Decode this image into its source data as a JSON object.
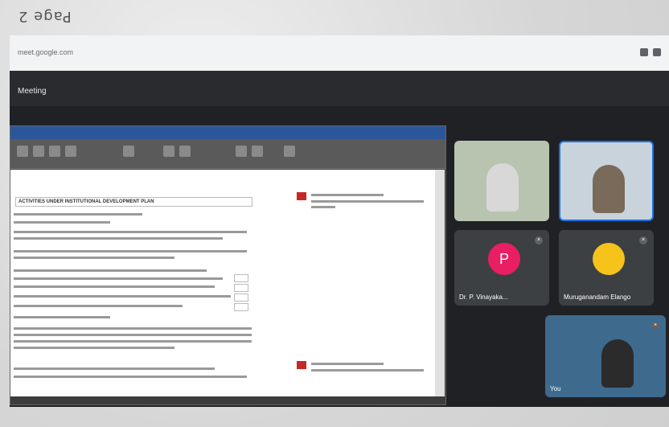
{
  "page_label": "Page 2",
  "browser": {
    "url": "meet.google.com"
  },
  "meeting": {
    "title": "Meeting"
  },
  "shared_document": {
    "window_title": "",
    "heading": "ACTIVITIES UNDER INSTITUTIONAL DEVELOPMENT PLAN"
  },
  "participants": [
    {
      "name": "",
      "kind": "video"
    },
    {
      "name": "",
      "kind": "video",
      "active_speaker": true
    },
    {
      "name": "Dr. P. Vinayaka...",
      "kind": "avatar",
      "avatar_letter": "P",
      "avatar_color": "#e91e63"
    },
    {
      "name": "Muruganandam Elango",
      "kind": "avatar",
      "avatar_color": "#f6c21c"
    },
    {
      "name": "You",
      "kind": "video"
    }
  ],
  "colors": {
    "meet_dark": "#202124",
    "accent": "#1a73e8"
  }
}
